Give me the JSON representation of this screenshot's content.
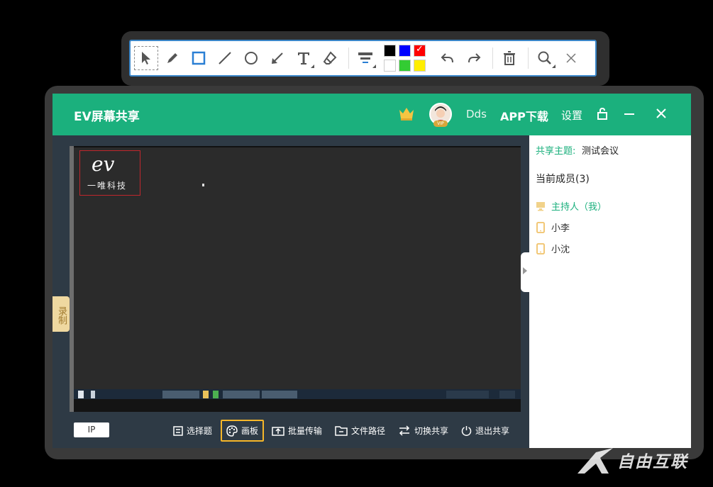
{
  "toolbar": {
    "tools": [
      "select-tool",
      "pen-tool",
      "rectangle-tool",
      "line-tool",
      "ellipse-tool",
      "arrow-tool",
      "text-tool",
      "eraser-tool",
      "line-width-tool"
    ],
    "colors": [
      "#000000",
      "#0000ff",
      "#ff0000",
      "#ffffff",
      "#33cc33",
      "#ffee00"
    ],
    "selected_color": "#ff0000",
    "actions": [
      "undo",
      "redo",
      "delete",
      "zoom",
      "close"
    ]
  },
  "window": {
    "title": "EV屏幕共享",
    "username": "Dds",
    "vip_badge": "VIP",
    "app_download": "APP下载",
    "settings": "设置",
    "accent": "#1bb07d"
  },
  "screen": {
    "logo_mark": "ev",
    "logo_text": "一唯科技"
  },
  "record_tab": "录制",
  "bottombar": {
    "ip": "IP",
    "buttons": [
      {
        "label": "选择题",
        "icon": "quiz-icon"
      },
      {
        "label": "画板",
        "icon": "palette-icon",
        "active": true
      },
      {
        "label": "批量传输",
        "icon": "upload-icon"
      },
      {
        "label": "文件路径",
        "icon": "folder-icon"
      },
      {
        "label": "切换共享",
        "icon": "swap-icon"
      },
      {
        "label": "退出共享",
        "icon": "power-icon"
      }
    ]
  },
  "panel": {
    "topic_label": "共享主题:",
    "topic_value": "测试会议",
    "members_title": "当前成员(3)",
    "members": [
      {
        "name": "主持人（我）",
        "icon": "monitor-icon",
        "host": true
      },
      {
        "name": "小李",
        "icon": "tablet-icon"
      },
      {
        "name": "小沈",
        "icon": "tablet-icon"
      }
    ]
  },
  "watermark": "自由互联"
}
